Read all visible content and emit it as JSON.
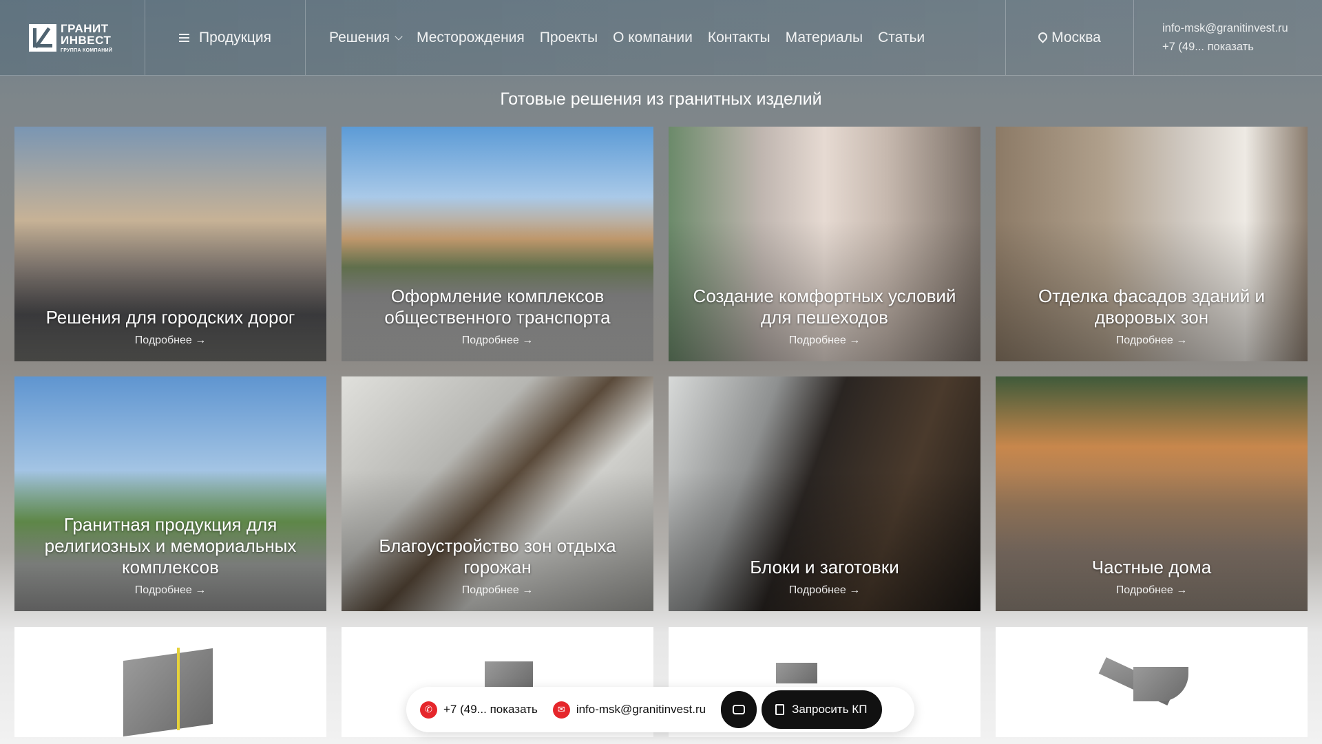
{
  "header": {
    "logo": {
      "line1": "ГРАНИТ",
      "line2": "ИНВЕСТ",
      "line3": "ГРУППА КОМПАНИЙ"
    },
    "products_label": "Продукция",
    "nav": [
      "Решения",
      "Месторождения",
      "Проекты",
      "О компании",
      "Контакты",
      "Материалы",
      "Статьи"
    ],
    "city": "Москва",
    "email": "info-msk@granitinvest.ru",
    "phone": "+7 (49... показать"
  },
  "section_title": "Готовые решения из гранитных изделий",
  "cards": [
    {
      "title": "Решения для городских дорог",
      "more": "Подробнее →"
    },
    {
      "title": "Оформление комплексов общественного транспорта",
      "more": "Подробнее →"
    },
    {
      "title": "Создание комфортных условий для пешеходов",
      "more": "Подробнее →"
    },
    {
      "title": "Отделка фасадов зданий и дворовых зон",
      "more": "Подробнее →"
    },
    {
      "title": "Гранитная продукция для религиозных и мемориальных комплексов",
      "more": "Подробнее →"
    },
    {
      "title": "Благоустройство зон отдыха горожан",
      "more": "Подробнее →"
    },
    {
      "title": "Блоки и заготовки",
      "more": "Подробнее →"
    },
    {
      "title": "Частные дома",
      "more": "Подробнее →"
    }
  ],
  "float_bar": {
    "phone": "+7 (49... показать",
    "email": "info-msk@granitinvest.ru",
    "request_label": "Запросить КП"
  },
  "colors": {
    "accent_red": "#e5262b",
    "dark": "#111111"
  }
}
